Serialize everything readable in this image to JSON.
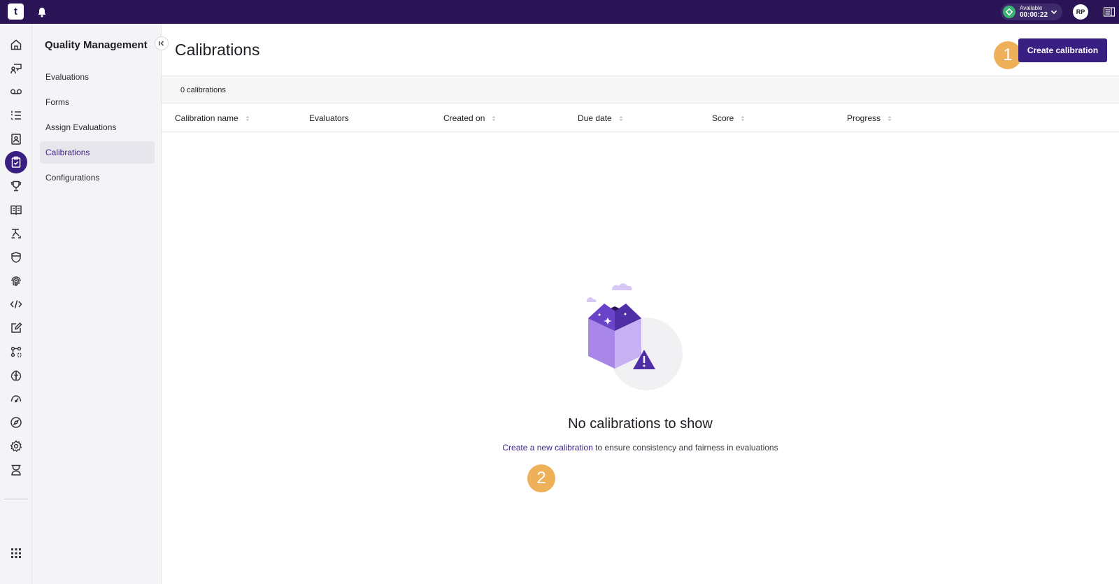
{
  "topbar": {
    "logo_text": "t",
    "status": {
      "label": "Available",
      "time": "00:00:22"
    },
    "avatar_initials": "RP"
  },
  "rail": {
    "icons": [
      "home-icon",
      "agent-chat-icon",
      "voicemail-icon",
      "list-icon",
      "contacts-icon",
      "clipboard-check-icon",
      "trophy-icon",
      "book-icon",
      "flow-icon",
      "shield-icon",
      "fingerprint-icon",
      "code-icon",
      "edit-icon",
      "integrations-icon",
      "brain-icon",
      "gauge-icon",
      "compass-icon",
      "gear-icon",
      "admin-icon",
      "apps-grid-icon"
    ],
    "active": "clipboard-check-icon"
  },
  "subnav": {
    "title": "Quality Management",
    "items": [
      {
        "label": "Evaluations"
      },
      {
        "label": "Forms"
      },
      {
        "label": "Assign Evaluations"
      },
      {
        "label": "Calibrations"
      },
      {
        "label": "Configurations"
      }
    ],
    "active": "Calibrations"
  },
  "main": {
    "title": "Calibrations",
    "create_button": "Create calibration",
    "count_text": "0 calibrations",
    "columns": [
      {
        "label": "Calibration name",
        "sortable": true
      },
      {
        "label": "Evaluators",
        "sortable": false
      },
      {
        "label": "Created on",
        "sortable": true
      },
      {
        "label": "Due date",
        "sortable": true
      },
      {
        "label": "Score",
        "sortable": true
      },
      {
        "label": "Progress",
        "sortable": true
      }
    ],
    "empty": {
      "title": "No calibrations to show",
      "link_text": "Create a new calibration",
      "rest_text": " to ensure consistency and fairness in evaluations"
    }
  },
  "markers": [
    "1",
    "2"
  ],
  "colors": {
    "topbar": "#2a1456",
    "accent": "#3a1f82",
    "marker": "#efb05a",
    "status_green": "#3bb373"
  }
}
